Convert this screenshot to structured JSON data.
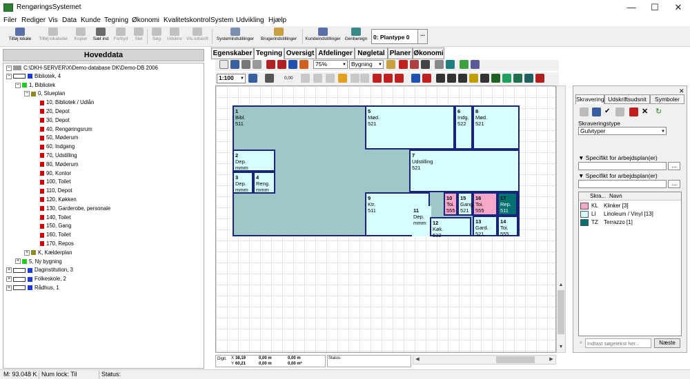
{
  "window": {
    "title": "RengøringsSystemet",
    "minimize": "—",
    "maximize": "☐",
    "close": "✕"
  },
  "menu": [
    "Filer",
    "Rediger",
    "Vis",
    "Data",
    "Kunde",
    "Tegning",
    "Økonomi",
    "Kvalitetskontrol",
    "System",
    "Udvikling",
    "Hjælp"
  ],
  "toolbar": {
    "buttons": [
      {
        "label": "Tilføj lokale",
        "icon": "add-room-icon",
        "enabled": true
      },
      {
        "label": "Tilføj lokaledel",
        "icon": "add-room-part-icon",
        "enabled": false
      },
      {
        "label": "Kopier",
        "icon": "copy-icon",
        "enabled": false
      },
      {
        "label": "Sæt ind",
        "icon": "paste-icon",
        "enabled": true
      },
      {
        "label": "Fortryd",
        "icon": "undo-icon",
        "enabled": false
      },
      {
        "label": "Slet",
        "icon": "delete-icon",
        "enabled": false
      },
      {
        "label": "Søg",
        "icon": "search-icon",
        "enabled": false
      },
      {
        "label": "Udskriv",
        "icon": "print-icon",
        "enabled": false
      },
      {
        "label": "Vis udskrift",
        "icon": "print-preview-icon",
        "enabled": false
      },
      {
        "label": "Systemindstillinger",
        "icon": "system-settings-icon",
        "enabled": true
      },
      {
        "label": "Brugerindstillinger",
        "icon": "user-settings-icon",
        "enabled": true
      },
      {
        "label": "Kundeindstillinger",
        "icon": "customer-settings-icon",
        "enabled": true
      },
      {
        "label": "Genberegn",
        "icon": "recalculate-icon",
        "enabled": true
      }
    ],
    "plan_selector": "0: Plantype 0",
    "plan_button": "..."
  },
  "left": {
    "header": "Hoveddata",
    "tree": [
      {
        "label": "C:\\DKH-SERVER\\X\\Demo-database DK\\Demo-DB 2006",
        "level": 0,
        "expander": "−",
        "icon": "database-icon",
        "color": "#555555"
      },
      {
        "label": "Bibliotek, 4",
        "level": 0,
        "expander": "−",
        "icon": "building-icon",
        "color": "#1a3bd6"
      },
      {
        "label": "1, Bibliotek",
        "level": 1,
        "expander": "−",
        "icon": "building-icon",
        "color": "#22cc22"
      },
      {
        "label": "0, Stueplan",
        "level": 2,
        "expander": "−",
        "icon": "floor-icon",
        "color": "#8a8a20"
      },
      {
        "label": "10, Bibliotek / Udlån",
        "level": 3,
        "expander": "",
        "icon": "room-icon",
        "color": "#d00000"
      },
      {
        "label": "20, Depot",
        "level": 3,
        "expander": "",
        "icon": "room-icon",
        "color": "#d00000"
      },
      {
        "label": "30, Depot",
        "level": 3,
        "expander": "",
        "icon": "room-icon",
        "color": "#d00000"
      },
      {
        "label": "40, Rengøringsrum",
        "level": 3,
        "expander": "",
        "icon": "room-icon",
        "color": "#d00000"
      },
      {
        "label": "50, Møderum",
        "level": 3,
        "expander": "",
        "icon": "room-icon",
        "color": "#d00000"
      },
      {
        "label": "60, Indgang",
        "level": 3,
        "expander": "",
        "icon": "room-icon",
        "color": "#d00000"
      },
      {
        "label": "70, Udstilling",
        "level": 3,
        "expander": "",
        "icon": "room-icon",
        "color": "#d00000"
      },
      {
        "label": "80, Møderum",
        "level": 3,
        "expander": "",
        "icon": "room-icon",
        "color": "#d00000"
      },
      {
        "label": "90, Kontor",
        "level": 3,
        "expander": "",
        "icon": "room-icon",
        "color": "#d00000"
      },
      {
        "label": "100, Toilet",
        "level": 3,
        "expander": "",
        "icon": "room-icon",
        "color": "#d00000"
      },
      {
        "label": "110, Depot",
        "level": 3,
        "expander": "",
        "icon": "room-icon",
        "color": "#d00000"
      },
      {
        "label": "120, Køkken",
        "level": 3,
        "expander": "",
        "icon": "room-icon",
        "color": "#d00000"
      },
      {
        "label": "130, Garderobe, personale",
        "level": 3,
        "expander": "",
        "icon": "room-icon",
        "color": "#d00000"
      },
      {
        "label": "140, Toilet",
        "level": 3,
        "expander": "",
        "icon": "room-icon",
        "color": "#d00000"
      },
      {
        "label": "150, Gang",
        "level": 3,
        "expander": "",
        "icon": "room-icon",
        "color": "#d00000"
      },
      {
        "label": "160, Toilet",
        "level": 3,
        "expander": "",
        "icon": "room-icon",
        "color": "#d00000"
      },
      {
        "label": "170, Repos",
        "level": 3,
        "expander": "",
        "icon": "room-icon",
        "color": "#d00000"
      },
      {
        "label": "K, Kælderplan",
        "level": 2,
        "expander": "+",
        "icon": "floor-icon",
        "color": "#8a8a20"
      },
      {
        "label": "5, Ny bygning",
        "level": 1,
        "expander": "+",
        "icon": "building-icon",
        "color": "#22cc22"
      },
      {
        "label": "Daginstitution, 3",
        "level": 0,
        "expander": "+",
        "icon": "building-icon",
        "color": "#1a3bd6"
      },
      {
        "label": "Folkeskole, 2",
        "level": 0,
        "expander": "+",
        "icon": "building-icon",
        "color": "#1a3bd6"
      },
      {
        "label": "Rådhus, 1",
        "level": 0,
        "expander": "+",
        "icon": "building-icon",
        "color": "#1a3bd6"
      }
    ]
  },
  "tabs": [
    "Egenskaber",
    "Tegning",
    "Oversigt",
    "Afdelinger",
    "Nøgletal",
    "Planer",
    "Økonomi"
  ],
  "active_tab": "Tegning",
  "drawing_toolbar": {
    "zoom": "75%",
    "layer": "Bygning",
    "scale": "1:100",
    "line_width": "0,00"
  },
  "rooms": [
    {
      "num": "1",
      "l1": "Bibl.",
      "l2": "511",
      "fill": "#9ec8c8"
    },
    {
      "num": "2",
      "l1": "Dep.",
      "l2": "mmm",
      "fill": "#d8ffff"
    },
    {
      "num": "3",
      "l1": "Dep.",
      "l2": "mmm",
      "fill": "#d8ffff"
    },
    {
      "num": "4",
      "l1": "Reng.",
      "l2": "mmm",
      "fill": "#d8ffff"
    },
    {
      "num": "5",
      "l1": "Mød.",
      "l2": "521",
      "fill": "#d8ffff"
    },
    {
      "num": "6",
      "l1": "Indg.",
      "l2": "522",
      "fill": "#d8ffff"
    },
    {
      "num": "8",
      "l1": "Mød.",
      "l2": "521",
      "fill": "#d8ffff"
    },
    {
      "num": "7",
      "l1": "Udstilling",
      "l2": "521",
      "fill": "#d8ffff"
    },
    {
      "num": "9",
      "l1": "Ktr.",
      "l2": "511",
      "fill": "#d8ffff"
    },
    {
      "num": "11",
      "l1": "Dep.",
      "l2": "mmm",
      "fill": "#d8ffff"
    },
    {
      "num": "12",
      "l1": "Køk.",
      "l2": "532",
      "fill": "#d8ffff"
    },
    {
      "num": "10",
      "l1": "Toi.",
      "l2": "555",
      "fill": "#f7a8c8"
    },
    {
      "num": "15",
      "l1": "Gang",
      "l2": "521",
      "fill": "#d8ffff"
    },
    {
      "num": "16",
      "l1": "Toi.",
      "l2": "555",
      "fill": "#f7a8c8"
    },
    {
      "num": "13",
      "l1": "Gard.",
      "l2": "521",
      "fill": "#d8ffff"
    },
    {
      "num": "17",
      "l1": "Rep.",
      "l2": "511",
      "fill": "#007070"
    },
    {
      "num": "14",
      "l1": "Toi.",
      "l2": "555",
      "fill": "#d8ffff"
    }
  ],
  "status_box": {
    "label": "Digit.",
    "x_label": "X",
    "x": "38,19",
    "y_label": "Y",
    "y": "60,21",
    "v1": "0,00 m",
    "v2": "0,00 m",
    "v3": "0,00 m",
    "v4": "0,00 m²"
  },
  "status_box2": "Status:",
  "right_panel": {
    "tabs": [
      "Skravering",
      "Udskriftsudsnit",
      "Symboler"
    ],
    "type_label": "Skraveringstype",
    "type_value": "Gulvtyper",
    "spec1": "Specifikt for arbejdsplan(er)",
    "spec2": "Specifikt for arbejdsplan(er)",
    "spec_button": "...",
    "list_headers": [
      "Skra...",
      "Navn"
    ],
    "list": [
      {
        "code": "KL",
        "name": "Klinker [3]",
        "color": "#f7a8c8"
      },
      {
        "code": "LI",
        "name": "Linoleum / Vinyl [13]",
        "color": "#d8ffff"
      },
      {
        "code": "TZ",
        "name": "Terrazzo [1]",
        "color": "#007070"
      }
    ],
    "search_placeholder": "Indtast søgetekst her...",
    "next_button": "Næste"
  },
  "statusbar": {
    "m": "M: 93.048 K",
    "numlock": "Num lock: Til",
    "status": "Status:"
  }
}
